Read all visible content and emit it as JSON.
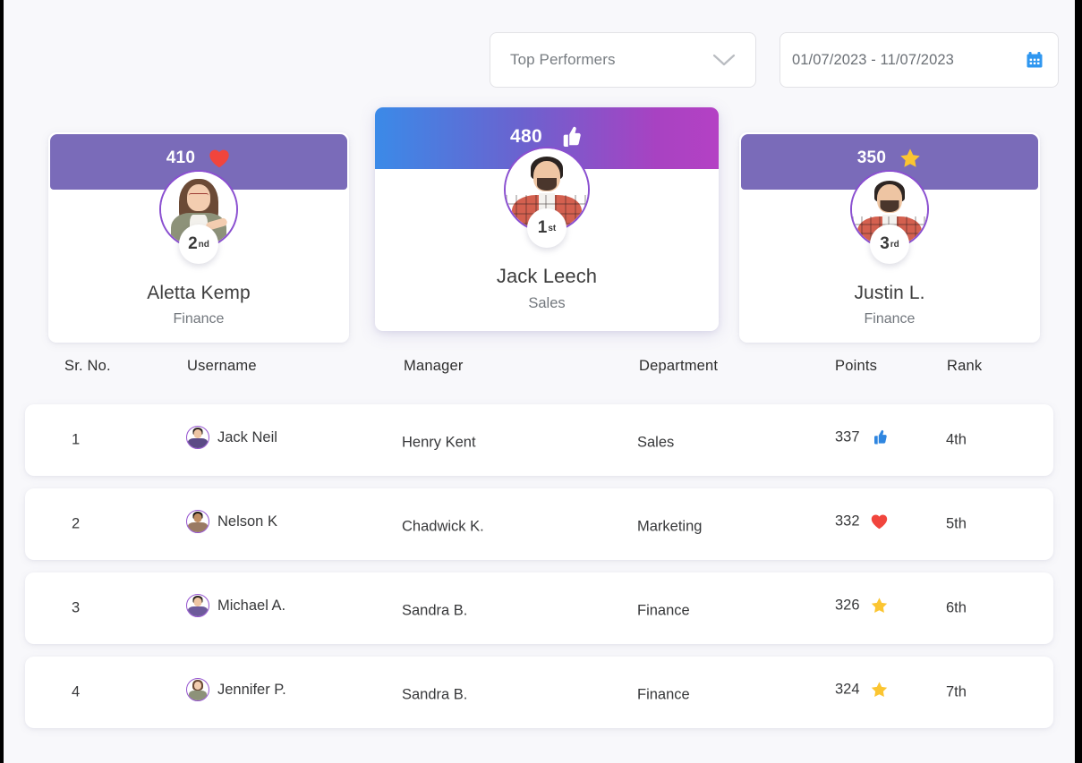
{
  "filters": {
    "select": {
      "label": "Top Performers",
      "icon": "chevron-down-icon"
    },
    "date_range": {
      "value": "01/07/2023 - 11/07/2023",
      "icon": "calendar-icon",
      "icon_color": "#2f97f0"
    }
  },
  "podium": [
    {
      "position": "left",
      "points": "410",
      "icon": "heart-icon",
      "icon_color": "#f1453d",
      "rank_num": "2",
      "rank_suffix": "nd",
      "name": "Aletta Kemp",
      "department": "Finance",
      "band_color": "#7a6bb9"
    },
    {
      "position": "center",
      "points": "480",
      "icon": "thumbs-up-icon",
      "icon_color": "#ffffff",
      "rank_num": "1",
      "rank_suffix": "st",
      "name": "Jack Leech",
      "department": "Sales",
      "band_gradient_from": "#3b8ae8",
      "band_gradient_to": "#b441c4"
    },
    {
      "position": "right",
      "points": "350",
      "icon": "star-icon",
      "icon_color": "#fbc531",
      "rank_num": "3",
      "rank_suffix": "rd",
      "name": "Justin L.",
      "department": "Finance",
      "band_color": "#7a6bb9"
    }
  ],
  "table": {
    "columns": [
      "Sr. No.",
      "Username",
      "Manager",
      "Department",
      "Points",
      "Rank"
    ],
    "rows": [
      {
        "sr_no": "1",
        "username": "Jack Neil",
        "manager": "Henry Kent",
        "department": "Sales",
        "points": "337",
        "points_icon": "thumbs-up-icon",
        "points_icon_color": "#2f86e0",
        "rank": "4th"
      },
      {
        "sr_no": "2",
        "username": "Nelson K",
        "manager": "Chadwick K.",
        "department": "Marketing",
        "points": "332",
        "points_icon": "heart-icon",
        "points_icon_color": "#f1453d",
        "rank": "5th"
      },
      {
        "sr_no": "3",
        "username": "Michael A.",
        "manager": "Sandra B.",
        "department": "Finance",
        "points": "326",
        "points_icon": "star-icon",
        "points_icon_color": "#fbc531",
        "rank": "6th"
      },
      {
        "sr_no": "4",
        "username": "Jennifer P.",
        "manager": "Sandra B.",
        "department": "Finance",
        "points": "324",
        "points_icon": "star-icon",
        "points_icon_color": "#fbc531",
        "rank": "7th"
      }
    ]
  }
}
